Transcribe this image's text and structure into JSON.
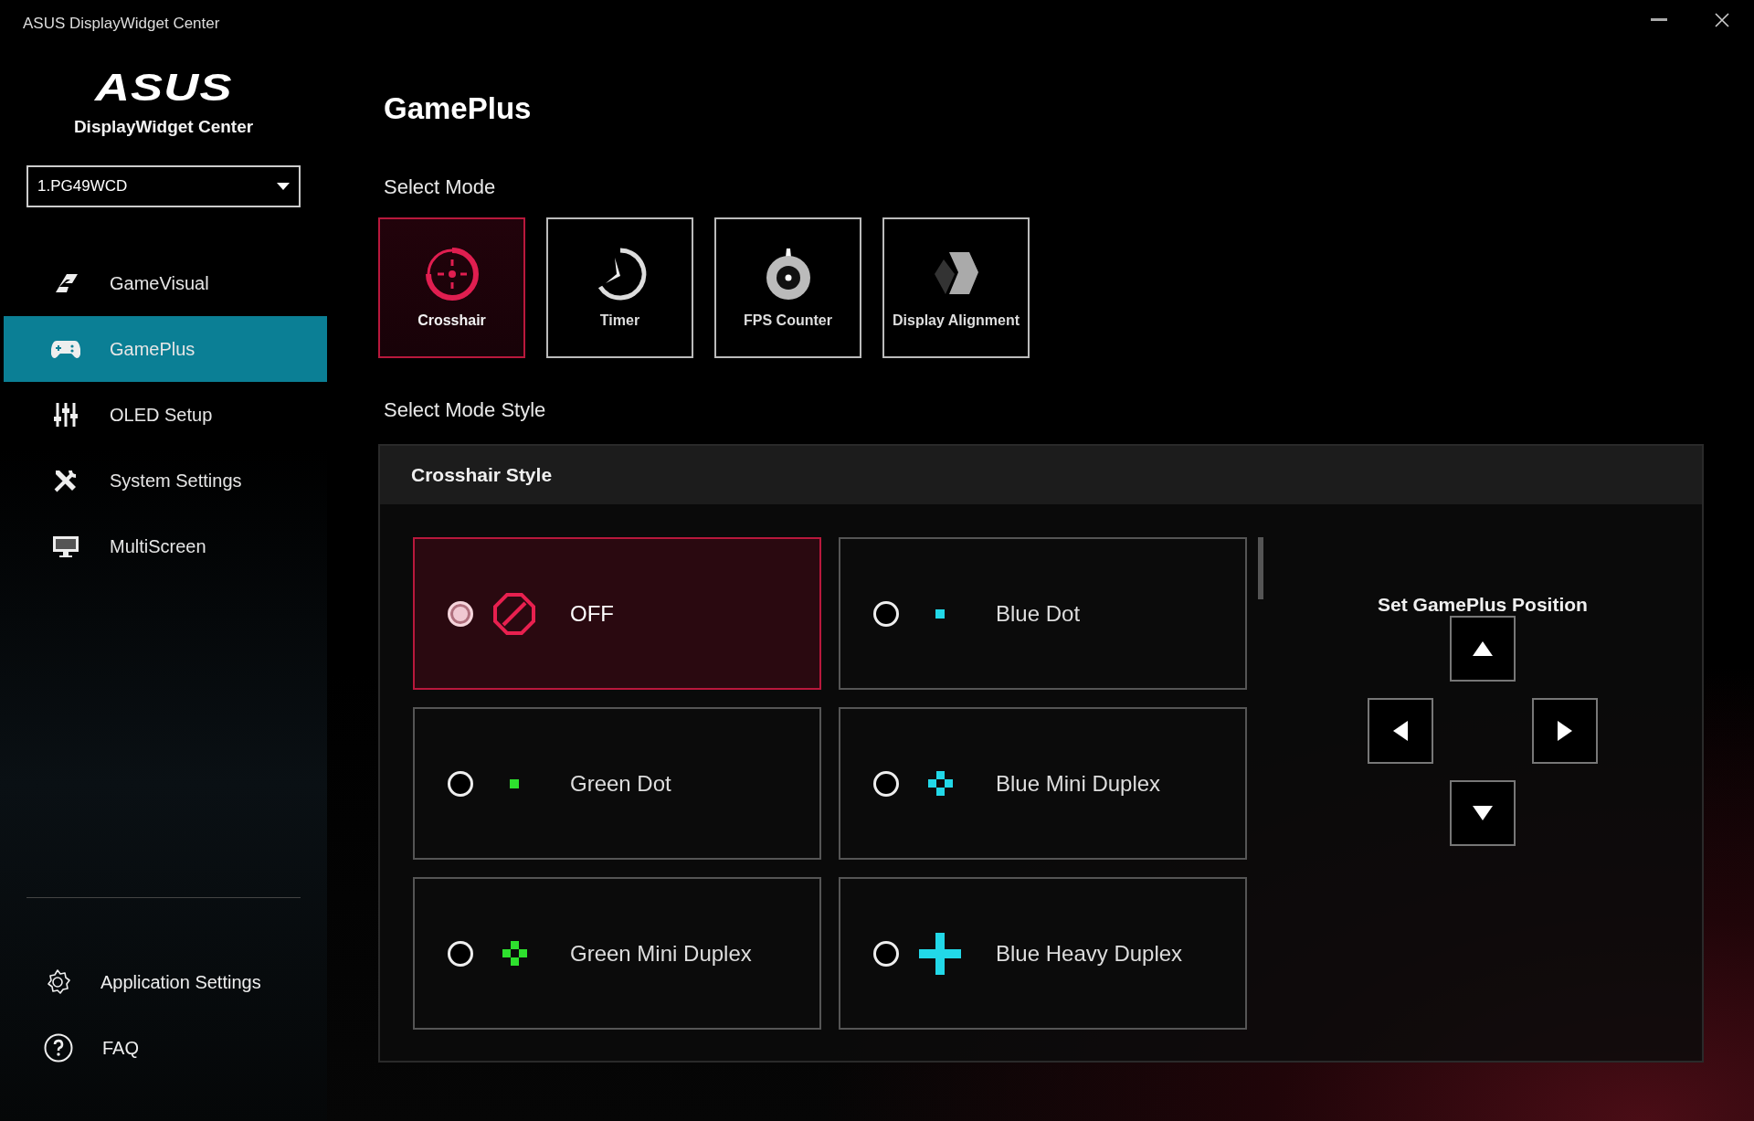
{
  "window": {
    "title": "ASUS DisplayWidget Center"
  },
  "sidebar": {
    "logo": "ASUS",
    "app_name": "DisplayWidget Center",
    "monitor_select": {
      "value": "1.PG49WCD"
    },
    "nav_items": [
      {
        "label": "GameVisual",
        "selected": false
      },
      {
        "label": "GamePlus",
        "selected": true
      },
      {
        "label": "OLED Setup",
        "selected": false
      },
      {
        "label": "System Settings",
        "selected": false
      },
      {
        "label": "MultiScreen",
        "selected": false
      }
    ],
    "footer_items": [
      {
        "label": "Application Settings"
      },
      {
        "label": "FAQ"
      }
    ]
  },
  "main": {
    "title": "GamePlus",
    "mode_heading": "Select Mode",
    "modes": [
      {
        "label": "Crosshair",
        "selected": true
      },
      {
        "label": "Timer",
        "selected": false
      },
      {
        "label": "FPS Counter",
        "selected": false
      },
      {
        "label": "Display Alignment",
        "selected": false
      }
    ],
    "style_heading": "Select Mode Style",
    "style_panel": {
      "title": "Crosshair Style",
      "options": [
        {
          "label": "OFF",
          "kind": "off",
          "color": "#e8204f",
          "selected": true
        },
        {
          "label": "Blue Dot",
          "kind": "dot",
          "color": "#22d8e8",
          "selected": false
        },
        {
          "label": "Green Dot",
          "kind": "dot",
          "color": "#2ee02e",
          "selected": false
        },
        {
          "label": "Blue Mini Duplex",
          "kind": "mini",
          "color": "#22d8e8",
          "selected": false
        },
        {
          "label": "Green Mini Duplex",
          "kind": "mini",
          "color": "#2ee02e",
          "selected": false
        },
        {
          "label": "Blue Heavy Duplex",
          "kind": "heavy",
          "color": "#22d8e8",
          "selected": false
        }
      ]
    },
    "position": {
      "title": "Set GamePlus Position"
    }
  }
}
